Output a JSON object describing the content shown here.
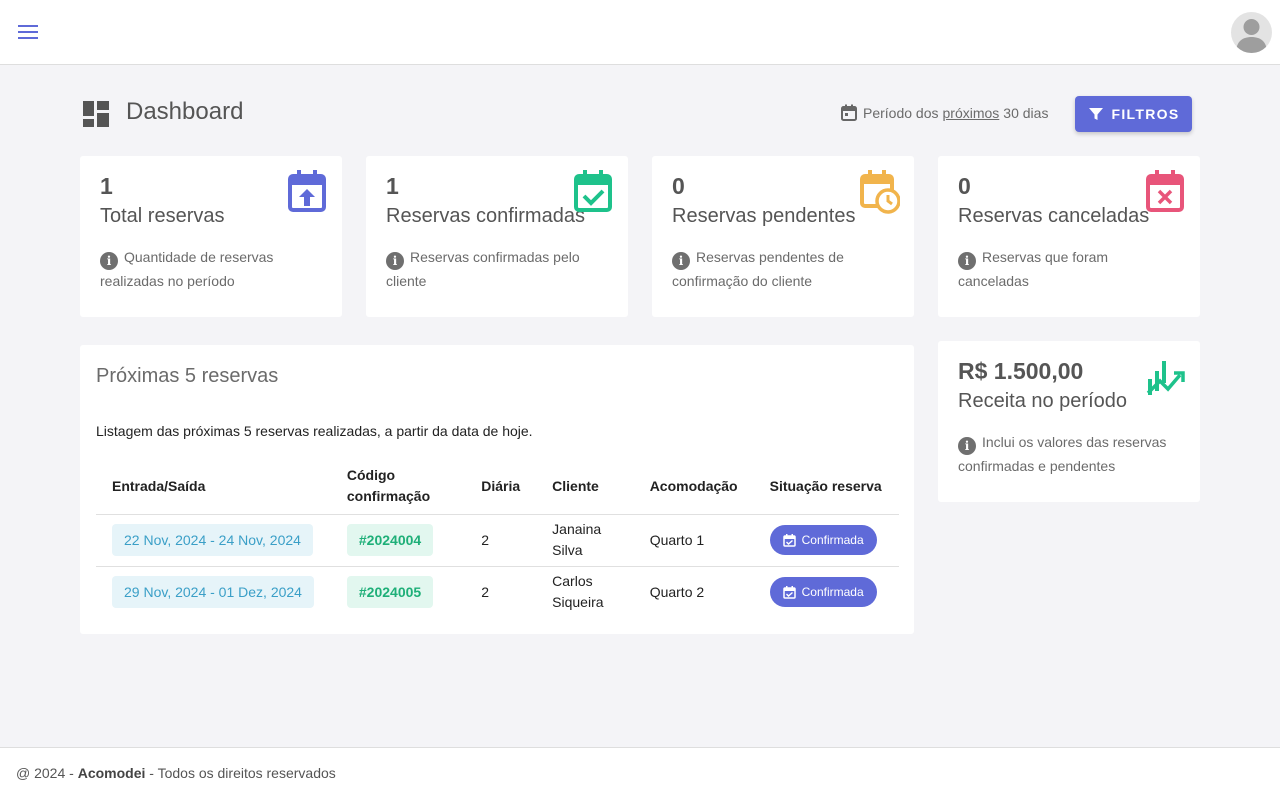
{
  "header": {
    "menu_icon": "menu-icon",
    "avatar_icon": "user-avatar"
  },
  "page": {
    "title": "Dashboard",
    "period_prefix": "Período dos",
    "period_link": "próximos",
    "period_suffix": "30 dias",
    "filter_label": "FILTROS"
  },
  "stats": [
    {
      "value": "1",
      "label": "Total reservas",
      "desc": "Quantidade de reservas realizadas no período",
      "icon": "calendar-upload-icon",
      "color": "#5f6ad8"
    },
    {
      "value": "1",
      "label": "Reservas confirmadas",
      "desc": "Reservas confirmadas pelo cliente",
      "icon": "calendar-check-icon",
      "color": "#1ec28b"
    },
    {
      "value": "0",
      "label": "Reservas pendentes",
      "desc": "Reservas pendentes de confirmação do cliente",
      "icon": "calendar-clock-icon",
      "color": "#f1b44c"
    },
    {
      "value": "0",
      "label": "Reservas canceladas",
      "desc": "Reservas que foram canceladas",
      "icon": "calendar-remove-icon",
      "color": "#e8557a"
    }
  ],
  "revenue": {
    "value": "R$ 1.500,00",
    "label": "Receita no período",
    "desc": "Inclui os valores das reservas confirmadas e pendentes",
    "icon": "chart-trend-icon",
    "color": "#1ec28b"
  },
  "list": {
    "title": "Próximas 5 reservas",
    "subtitle": "Listagem das próximas 5 reservas realizadas, a partir da data de hoje.",
    "columns": [
      "Entrada/Saída",
      "Código confirmação",
      "Diária",
      "Cliente",
      "Acomodação",
      "Situação reserva"
    ],
    "rows": [
      {
        "dates": "22 Nov, 2024 - 24 Nov, 2024",
        "code": "#2024004",
        "daily": "2",
        "client": "Janaina Silva",
        "room": "Quarto 1",
        "status": "Confirmada"
      },
      {
        "dates": "29 Nov, 2024 - 01 Dez, 2024",
        "code": "#2024005",
        "daily": "2",
        "client": "Carlos Siqueira",
        "room": "Quarto 2",
        "status": "Confirmada"
      }
    ]
  },
  "footer": {
    "prefix": "@ 2024 -",
    "brand": "Acomodei",
    "suffix": "- Todos os direitos reservados"
  },
  "colors": {
    "primary": "#5f6ad8",
    "success": "#1ec28b",
    "warning": "#f1b44c",
    "danger": "#e8557a",
    "info": "#3a9fc7"
  }
}
